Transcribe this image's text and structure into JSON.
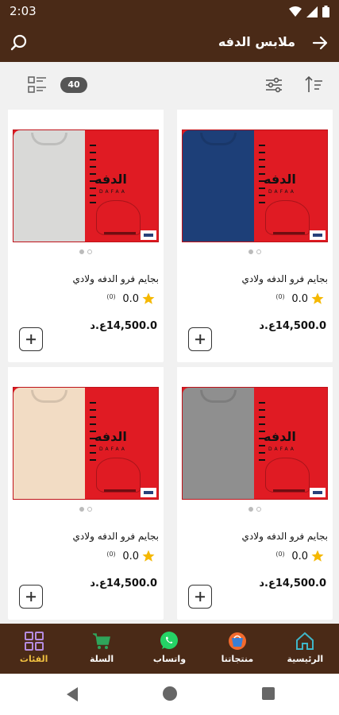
{
  "status_bar": {
    "time": "2:03"
  },
  "app_bar": {
    "title": "ملابس الدفه"
  },
  "toolbar": {
    "count": "40"
  },
  "products": [
    {
      "name": "بجايم فرو الدفه ولادي",
      "rating": "0.0",
      "rating_count": "(0)",
      "price": "14,500.0ع.د",
      "shirt_color": "#1d3f78",
      "brand_ar": "الدفه",
      "brand_lat": "DAFAA"
    },
    {
      "name": "بجايم فرو الدفه ولادي",
      "rating": "0.0",
      "rating_count": "(0)",
      "price": "14,500.0ع.د",
      "shirt_color": "#d9d9d7",
      "brand_ar": "الدفه",
      "brand_lat": "DAFAA"
    },
    {
      "name": "بجايم فرو الدفه ولادي",
      "rating": "0.0",
      "rating_count": "(0)",
      "price": "14,500.0ع.د",
      "shirt_color": "#8f8f8f",
      "brand_ar": "الدفه",
      "brand_lat": "DAFAA"
    },
    {
      "name": "بجايم فرو الدفه ولادي",
      "rating": "0.0",
      "rating_count": "(0)",
      "price": "14,500.0ع.د",
      "shirt_color": "#f2dcc4",
      "brand_ar": "الدفه",
      "brand_lat": "DAFAA"
    }
  ],
  "bottom_nav": [
    {
      "label": "الرئيسية",
      "icon": "home-icon"
    },
    {
      "label": "منتجاتنا",
      "icon": "products-icon"
    },
    {
      "label": "واتساب",
      "icon": "whatsapp-icon"
    },
    {
      "label": "السلة",
      "icon": "cart-icon"
    },
    {
      "label": "الفئات",
      "icon": "categories-icon",
      "active": true
    }
  ],
  "colors": {
    "brand_brown": "#4a2a17",
    "box_red": "#e01b23",
    "active_nav": "#f0c040"
  }
}
